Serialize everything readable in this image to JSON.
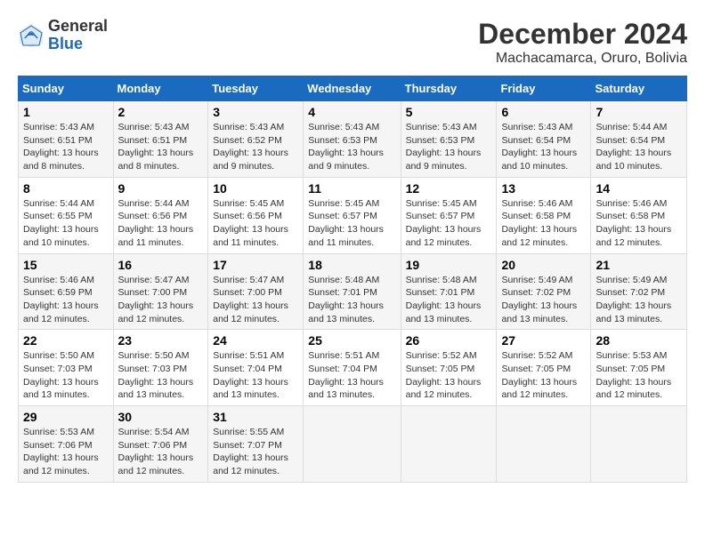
{
  "logo": {
    "general": "General",
    "blue": "Blue"
  },
  "title": "December 2024",
  "location": "Machacamarca, Oruro, Bolivia",
  "days_of_week": [
    "Sunday",
    "Monday",
    "Tuesday",
    "Wednesday",
    "Thursday",
    "Friday",
    "Saturday"
  ],
  "weeks": [
    [
      {
        "day": 1,
        "sunrise": "5:43 AM",
        "sunset": "6:51 PM",
        "daylight": "13 hours and 8 minutes."
      },
      {
        "day": 2,
        "sunrise": "5:43 AM",
        "sunset": "6:51 PM",
        "daylight": "13 hours and 8 minutes."
      },
      {
        "day": 3,
        "sunrise": "5:43 AM",
        "sunset": "6:52 PM",
        "daylight": "13 hours and 9 minutes."
      },
      {
        "day": 4,
        "sunrise": "5:43 AM",
        "sunset": "6:53 PM",
        "daylight": "13 hours and 9 minutes."
      },
      {
        "day": 5,
        "sunrise": "5:43 AM",
        "sunset": "6:53 PM",
        "daylight": "13 hours and 9 minutes."
      },
      {
        "day": 6,
        "sunrise": "5:43 AM",
        "sunset": "6:54 PM",
        "daylight": "13 hours and 10 minutes."
      },
      {
        "day": 7,
        "sunrise": "5:44 AM",
        "sunset": "6:54 PM",
        "daylight": "13 hours and 10 minutes."
      }
    ],
    [
      {
        "day": 8,
        "sunrise": "5:44 AM",
        "sunset": "6:55 PM",
        "daylight": "13 hours and 10 minutes."
      },
      {
        "day": 9,
        "sunrise": "5:44 AM",
        "sunset": "6:56 PM",
        "daylight": "13 hours and 11 minutes."
      },
      {
        "day": 10,
        "sunrise": "5:45 AM",
        "sunset": "6:56 PM",
        "daylight": "13 hours and 11 minutes."
      },
      {
        "day": 11,
        "sunrise": "5:45 AM",
        "sunset": "6:57 PM",
        "daylight": "13 hours and 11 minutes."
      },
      {
        "day": 12,
        "sunrise": "5:45 AM",
        "sunset": "6:57 PM",
        "daylight": "13 hours and 12 minutes."
      },
      {
        "day": 13,
        "sunrise": "5:46 AM",
        "sunset": "6:58 PM",
        "daylight": "13 hours and 12 minutes."
      },
      {
        "day": 14,
        "sunrise": "5:46 AM",
        "sunset": "6:58 PM",
        "daylight": "13 hours and 12 minutes."
      }
    ],
    [
      {
        "day": 15,
        "sunrise": "5:46 AM",
        "sunset": "6:59 PM",
        "daylight": "13 hours and 12 minutes."
      },
      {
        "day": 16,
        "sunrise": "5:47 AM",
        "sunset": "7:00 PM",
        "daylight": "13 hours and 12 minutes."
      },
      {
        "day": 17,
        "sunrise": "5:47 AM",
        "sunset": "7:00 PM",
        "daylight": "13 hours and 12 minutes."
      },
      {
        "day": 18,
        "sunrise": "5:48 AM",
        "sunset": "7:01 PM",
        "daylight": "13 hours and 13 minutes."
      },
      {
        "day": 19,
        "sunrise": "5:48 AM",
        "sunset": "7:01 PM",
        "daylight": "13 hours and 13 minutes."
      },
      {
        "day": 20,
        "sunrise": "5:49 AM",
        "sunset": "7:02 PM",
        "daylight": "13 hours and 13 minutes."
      },
      {
        "day": 21,
        "sunrise": "5:49 AM",
        "sunset": "7:02 PM",
        "daylight": "13 hours and 13 minutes."
      }
    ],
    [
      {
        "day": 22,
        "sunrise": "5:50 AM",
        "sunset": "7:03 PM",
        "daylight": "13 hours and 13 minutes."
      },
      {
        "day": 23,
        "sunrise": "5:50 AM",
        "sunset": "7:03 PM",
        "daylight": "13 hours and 13 minutes."
      },
      {
        "day": 24,
        "sunrise": "5:51 AM",
        "sunset": "7:04 PM",
        "daylight": "13 hours and 13 minutes."
      },
      {
        "day": 25,
        "sunrise": "5:51 AM",
        "sunset": "7:04 PM",
        "daylight": "13 hours and 13 minutes."
      },
      {
        "day": 26,
        "sunrise": "5:52 AM",
        "sunset": "7:05 PM",
        "daylight": "13 hours and 12 minutes."
      },
      {
        "day": 27,
        "sunrise": "5:52 AM",
        "sunset": "7:05 PM",
        "daylight": "13 hours and 12 minutes."
      },
      {
        "day": 28,
        "sunrise": "5:53 AM",
        "sunset": "7:05 PM",
        "daylight": "13 hours and 12 minutes."
      }
    ],
    [
      {
        "day": 29,
        "sunrise": "5:53 AM",
        "sunset": "7:06 PM",
        "daylight": "13 hours and 12 minutes."
      },
      {
        "day": 30,
        "sunrise": "5:54 AM",
        "sunset": "7:06 PM",
        "daylight": "13 hours and 12 minutes."
      },
      {
        "day": 31,
        "sunrise": "5:55 AM",
        "sunset": "7:07 PM",
        "daylight": "13 hours and 12 minutes."
      },
      null,
      null,
      null,
      null
    ]
  ]
}
